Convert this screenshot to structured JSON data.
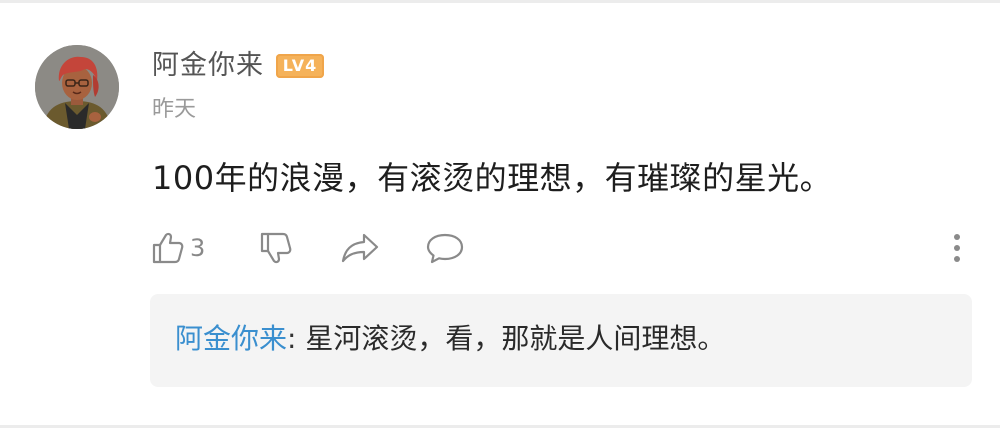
{
  "comment": {
    "username": "阿金你来",
    "level_badge": "LV4",
    "timestamp": "昨天",
    "text": "100年的浪漫，有滚烫的理想，有璀璨的星光。",
    "like_count": "3",
    "icons": {
      "like": "thumbs-up-icon",
      "dislike": "thumbs-down-icon",
      "share": "share-arrow-icon",
      "reply": "speech-bubble-icon",
      "more": "more-vertical-icon"
    }
  },
  "reply": {
    "author": "阿金你来",
    "separator": ": ",
    "text": "星河滚烫，看，那就是人间理想。"
  },
  "colors": {
    "username": "#555555",
    "badge": "#f5b25a",
    "timestamp": "#9a9a9a",
    "reply_author": "#3a8fcf",
    "reply_bg": "#f4f4f4",
    "icon": "#8a8a8a"
  }
}
